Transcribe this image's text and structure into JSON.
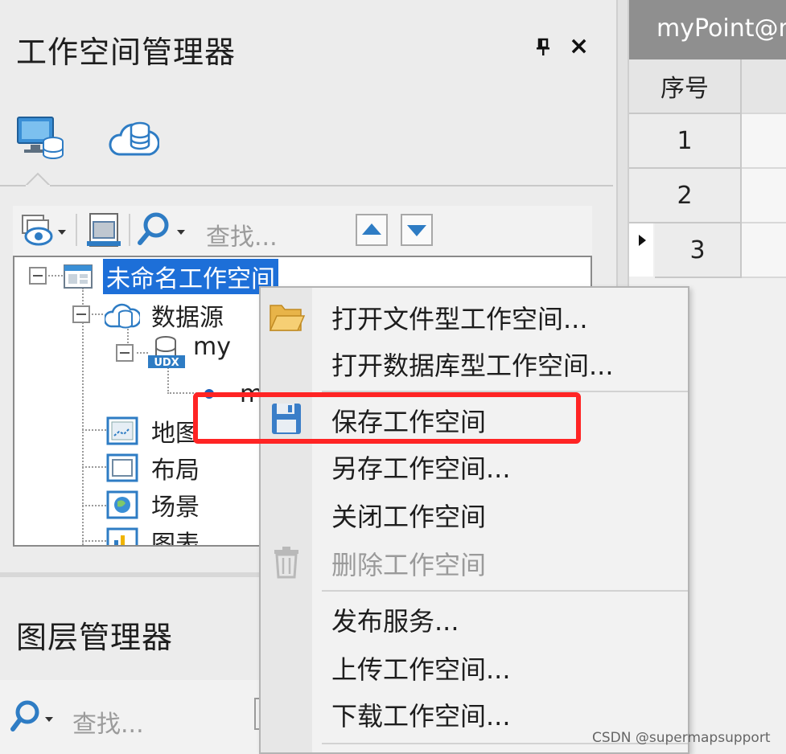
{
  "workspace_manager": {
    "title": "工作空间管理器",
    "tabs": [
      {
        "icon": "local-workspace-icon"
      },
      {
        "icon": "cloud-database-icon"
      }
    ],
    "toolbar": {
      "search_placeholder": "查找..."
    },
    "tree": {
      "root": "未命名工作空间",
      "datasource_group": "数据源",
      "datasource": "my",
      "dataset_partial": "m",
      "maps": "地图",
      "layouts": "布局",
      "scenes": "场景",
      "charts_partial": "图表"
    }
  },
  "layer_manager": {
    "title": "图层管理器",
    "search_placeholder": "查找..."
  },
  "attribute_table": {
    "tab_label": "myPoint@my",
    "header": "序号",
    "rows": [
      "1",
      "2",
      "3"
    ]
  },
  "context_menu": {
    "items": [
      {
        "label": "打开文件型工作空间...",
        "icon": "folder-open-icon",
        "disabled": false
      },
      {
        "label": "打开数据库型工作空间...",
        "icon": "",
        "disabled": false
      },
      {
        "label": "保存工作空间",
        "icon": "save-icon",
        "disabled": false,
        "highlighted": true
      },
      {
        "label": "另存工作空间...",
        "icon": "",
        "disabled": false
      },
      {
        "label": "关闭工作空间",
        "icon": "",
        "disabled": false
      },
      {
        "label": "删除工作空间",
        "icon": "trash-icon",
        "disabled": true
      },
      {
        "label": "发布服务...",
        "icon": "",
        "disabled": false
      },
      {
        "label": "上传工作空间...",
        "icon": "",
        "disabled": false
      },
      {
        "label": "下载工作空间...",
        "icon": "",
        "disabled": false
      }
    ]
  },
  "colors": {
    "selection": "#1d6fd8",
    "highlight_box": "#ff2424",
    "tab_header": "#8f8f8f"
  },
  "watermark": "CSDN @supermapsupport"
}
